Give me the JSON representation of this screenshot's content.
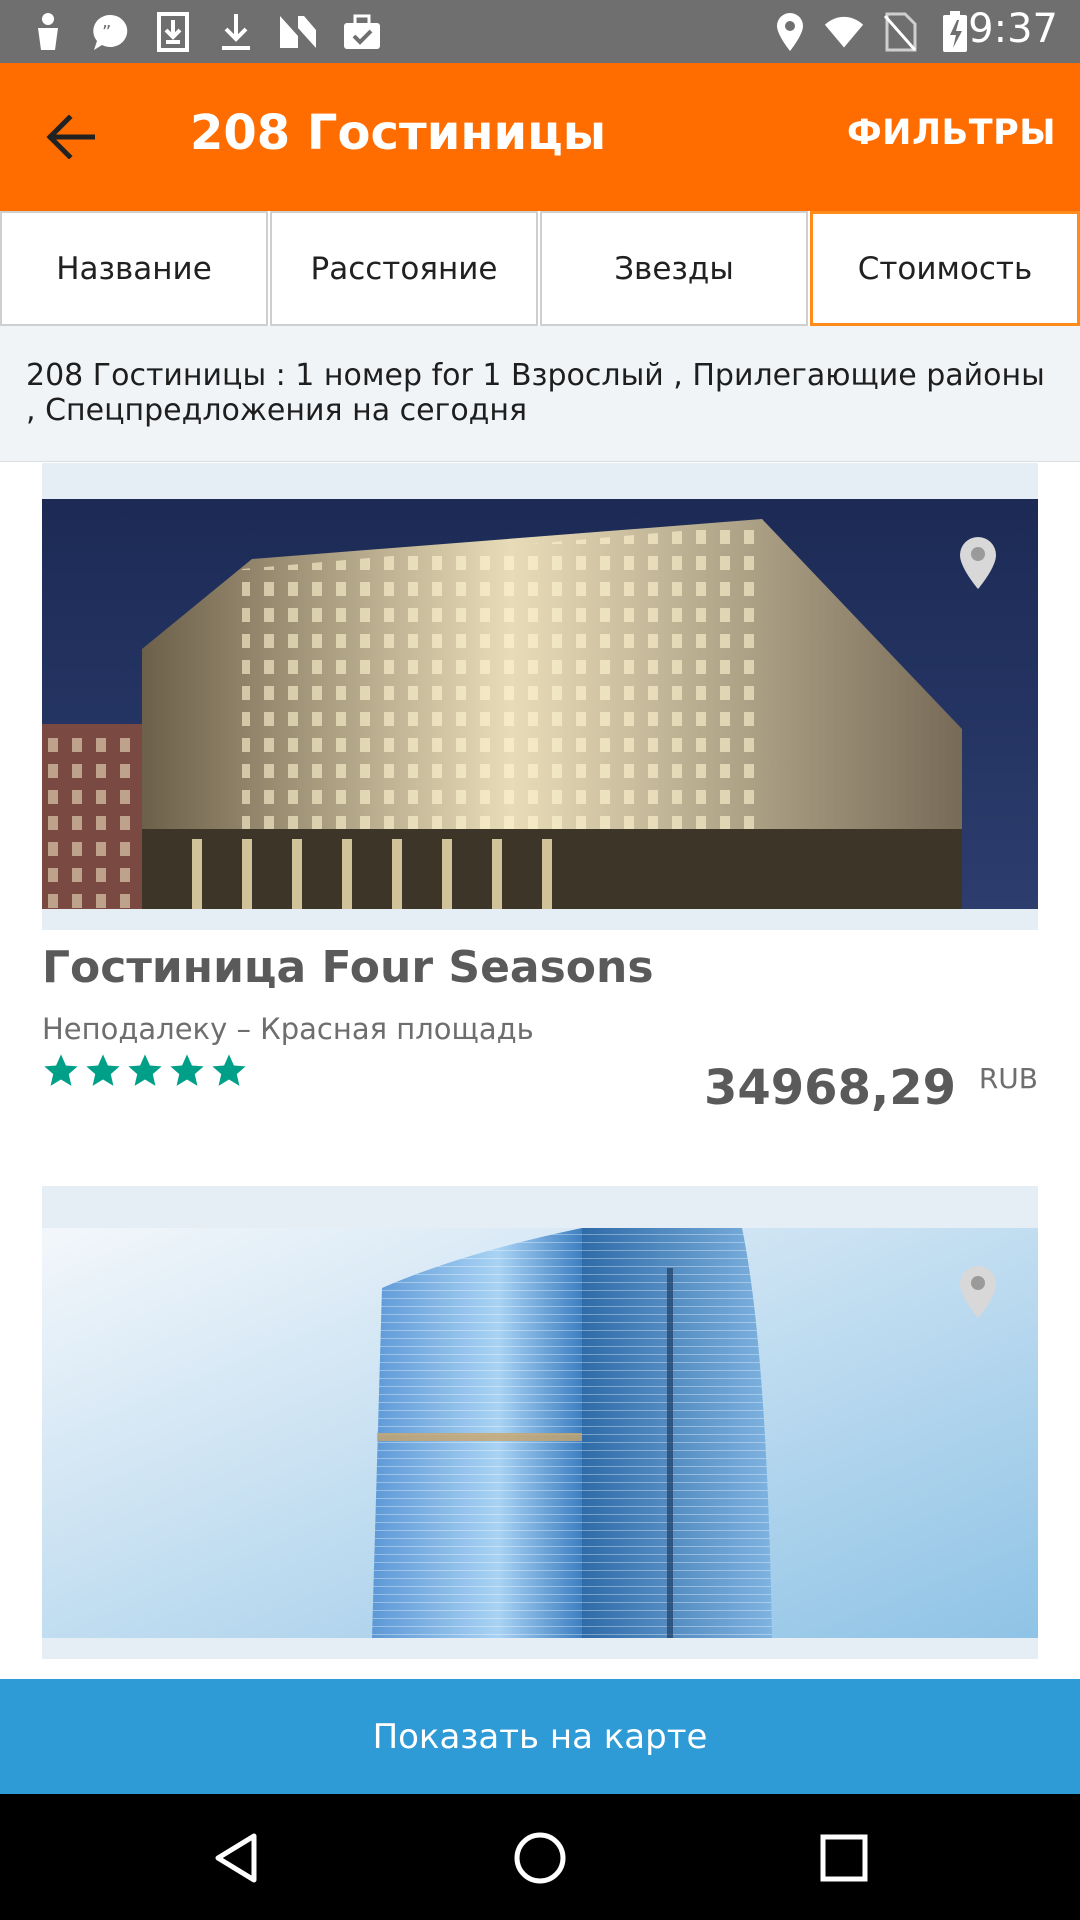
{
  "status_bar": {
    "time": "9:37",
    "left_icons": [
      "person-icon",
      "quote-icon",
      "download-box-icon",
      "download-icon",
      "n-logo-icon",
      "briefcase-check-icon"
    ],
    "right_icons": [
      "location-icon",
      "wifi-icon",
      "no-sim-icon",
      "battery-charging-icon"
    ]
  },
  "app_bar": {
    "title": "208 Гостиницы",
    "filters_label": "ФИЛЬТРЫ",
    "back_icon": "arrow-back-icon"
  },
  "sort_tabs": [
    {
      "label": "Название",
      "active": false
    },
    {
      "label": "Расстояние",
      "active": false
    },
    {
      "label": "Звезды",
      "active": false
    },
    {
      "label": "Стоимость",
      "active": true
    }
  ],
  "summary": "208 Гостиницы : 1 номер for 1 Взрослый , Прилегающие районы , Спецпредложения на сегодня",
  "hotels": [
    {
      "name": "Гостиница Four Seasons",
      "area": "Неподалеку – Красная площадь",
      "stars": 5,
      "price": "34968,29",
      "currency": "RUB"
    },
    {
      "name": "",
      "area": "",
      "stars": null,
      "price": "",
      "currency": ""
    }
  ],
  "map_button_label": "Показать на карте",
  "colors": {
    "accent": "#ff6d00",
    "tab_active_border": "#ff8c1a",
    "star": "#00a088",
    "map_button": "#2e9bd6"
  },
  "nav_bar": [
    "back-triangle-icon",
    "home-circle-icon",
    "recents-square-icon"
  ]
}
